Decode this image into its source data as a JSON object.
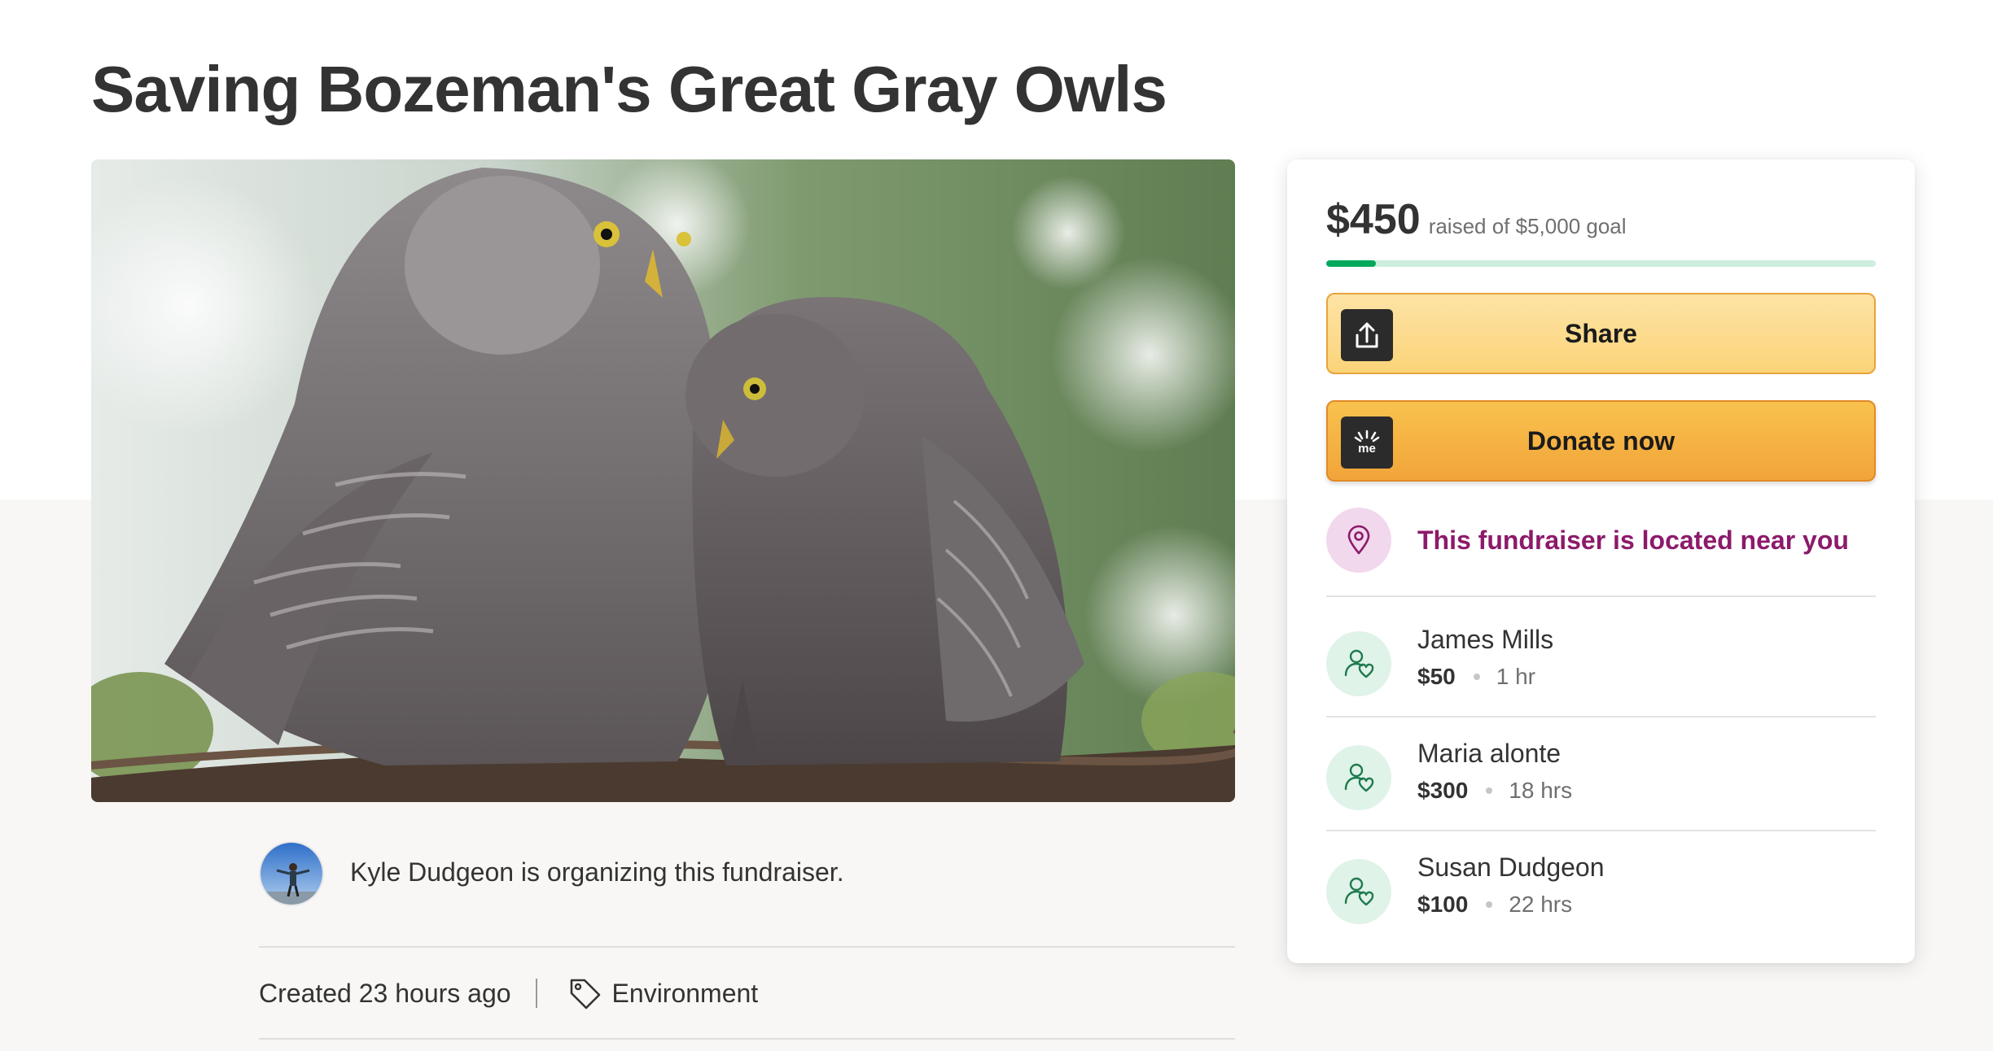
{
  "page": {
    "title": "Saving Bozeman's Great Gray Owls"
  },
  "organizer": {
    "text": "Kyle Dudgeon is organizing this fundraiser."
  },
  "meta": {
    "created": "Created 23 hours ago",
    "category": "Environment"
  },
  "donation_card": {
    "raised_amount": "$450",
    "goal_text": "raised of $5,000 goal",
    "progress_percent": 9,
    "share_label": "Share",
    "donate_label": "Donate now",
    "donate_icon_text": "me",
    "nearby_text": "This fundraiser is located near you",
    "donations": [
      {
        "name": "James Mills",
        "amount": "$50",
        "time": "1 hr"
      },
      {
        "name": "Maria alonte",
        "amount": "$300",
        "time": "18 hrs"
      },
      {
        "name": "Susan Dudgeon",
        "amount": "$100",
        "time": "22 hrs"
      }
    ]
  },
  "colors": {
    "progress_fill": "#02a95c",
    "progress_track": "#cdeedd",
    "donate_button": "#f2a43a",
    "share_button": "#fbd479",
    "nearby_text": "#8c1a6a"
  },
  "icons": {
    "share": "share-upload-icon",
    "donate": "gofundme-logo-icon",
    "location": "location-pin-icon",
    "donor": "donor-heart-person-icon",
    "category": "tag-icon"
  }
}
